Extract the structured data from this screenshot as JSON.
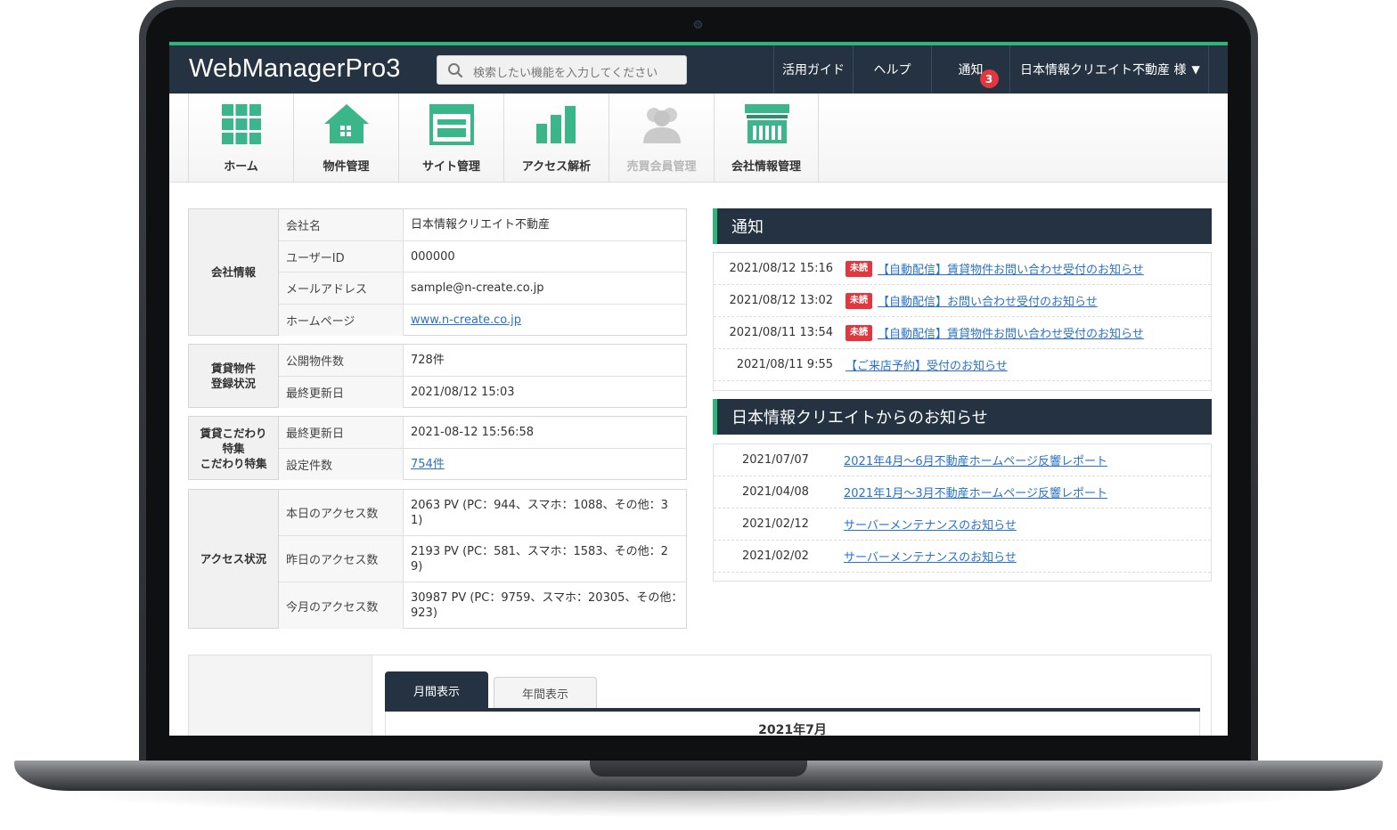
{
  "header": {
    "logo": "WebManagerPro3",
    "search_placeholder": "検索したい機能を入力してください",
    "nav_guide": "活用ガイド",
    "nav_help": "ヘルプ",
    "nav_notice": "通知",
    "notice_count": "3",
    "user_name": "日本情報クリエイト不動産 様",
    "caret": "▼"
  },
  "icon_nav": [
    {
      "label": "ホーム",
      "icon": "grid-icon"
    },
    {
      "label": "物件管理",
      "icon": "house-icon"
    },
    {
      "label": "サイト管理",
      "icon": "browser-window-icon"
    },
    {
      "label": "アクセス解析",
      "icon": "bar-chart-icon"
    },
    {
      "label": "売買会員管理",
      "icon": "members-icon",
      "disabled": true
    },
    {
      "label": "会社情報管理",
      "icon": "storefront-icon"
    }
  ],
  "company": {
    "heading": "会社情報",
    "rows": [
      {
        "label": "会社名",
        "value": "日本情報クリエイト不動産"
      },
      {
        "label": "ユーザーID",
        "value": "000000"
      },
      {
        "label": "メールアドレス",
        "value": "sample@n-create.co.jp"
      },
      {
        "label": "ホームページ",
        "value": "www.n-create.co.jp"
      }
    ]
  },
  "rental": {
    "heading_line1": "賃貸物件",
    "heading_line2": "登録状況",
    "rows": [
      {
        "label": "公開物件数",
        "value": "728件"
      },
      {
        "label": "最終更新日",
        "value": "2021/08/12 15:03"
      }
    ]
  },
  "feature": {
    "heading_line1": "賃貸こだわり",
    "heading_line2": "特集",
    "heading_line3": "こだわり特集",
    "rows": [
      {
        "label": "最終更新日",
        "value": "2021-08-12 15:56:58"
      },
      {
        "label": "設定件数",
        "value": "754件"
      }
    ]
  },
  "access": {
    "heading": "アクセス状況",
    "rows": [
      {
        "label": "本日のアクセス数",
        "value_line1": "2063 PV (PC：944、スマホ：1088、その他：3",
        "value_line2": "1)"
      },
      {
        "label": "昨日のアクセス数",
        "value_line1": "2193 PV (PC：581、スマホ：1583、その他：2",
        "value_line2": "9)"
      },
      {
        "label": "今月のアクセス数",
        "value_line1": "30987 PV (PC：9759、スマホ：20305、その他：",
        "value_line2": "923)"
      }
    ]
  },
  "notices": {
    "title": "通知",
    "unread_label": "未読",
    "items": [
      {
        "date": "2021/08/12 15:16",
        "unread": true,
        "text": "【自動配信】賃貸物件お問い合わせ受付のお知らせ"
      },
      {
        "date": "2021/08/12 13:02",
        "unread": true,
        "text": "【自動配信】お問い合わせ受付のお知らせ"
      },
      {
        "date": "2021/08/11 13:54",
        "unread": true,
        "text": "【自動配信】賃貸物件お問い合わせ受付のお知らせ"
      },
      {
        "date": "2021/08/11 9:55",
        "unread": false,
        "text": "【ご来店予約】受付のお知らせ"
      }
    ]
  },
  "news": {
    "title": "日本情報クリエイトからのお知らせ",
    "items": [
      {
        "date": "2021/07/07",
        "text": "2021年4月～6月不動産ホームページ反響レポート"
      },
      {
        "date": "2021/04/08",
        "text": "2021年1月～3月不動産ホームページ反響レポート"
      },
      {
        "date": "2021/02/12",
        "text": "サーバーメンテナンスのお知らせ"
      },
      {
        "date": "2021/02/02",
        "text": "サーバーメンテナンスのお知らせ"
      }
    ]
  },
  "calendar": {
    "tab_monthly": "月間表示",
    "tab_yearly": "年間表示",
    "month_title": "2021年7月"
  },
  "colors": {
    "navy": "#243241",
    "accent_green": "#2bb67a",
    "icon_green": "#3bb58a",
    "unread_red": "#e0383e",
    "link_blue": "#2a72c8"
  }
}
